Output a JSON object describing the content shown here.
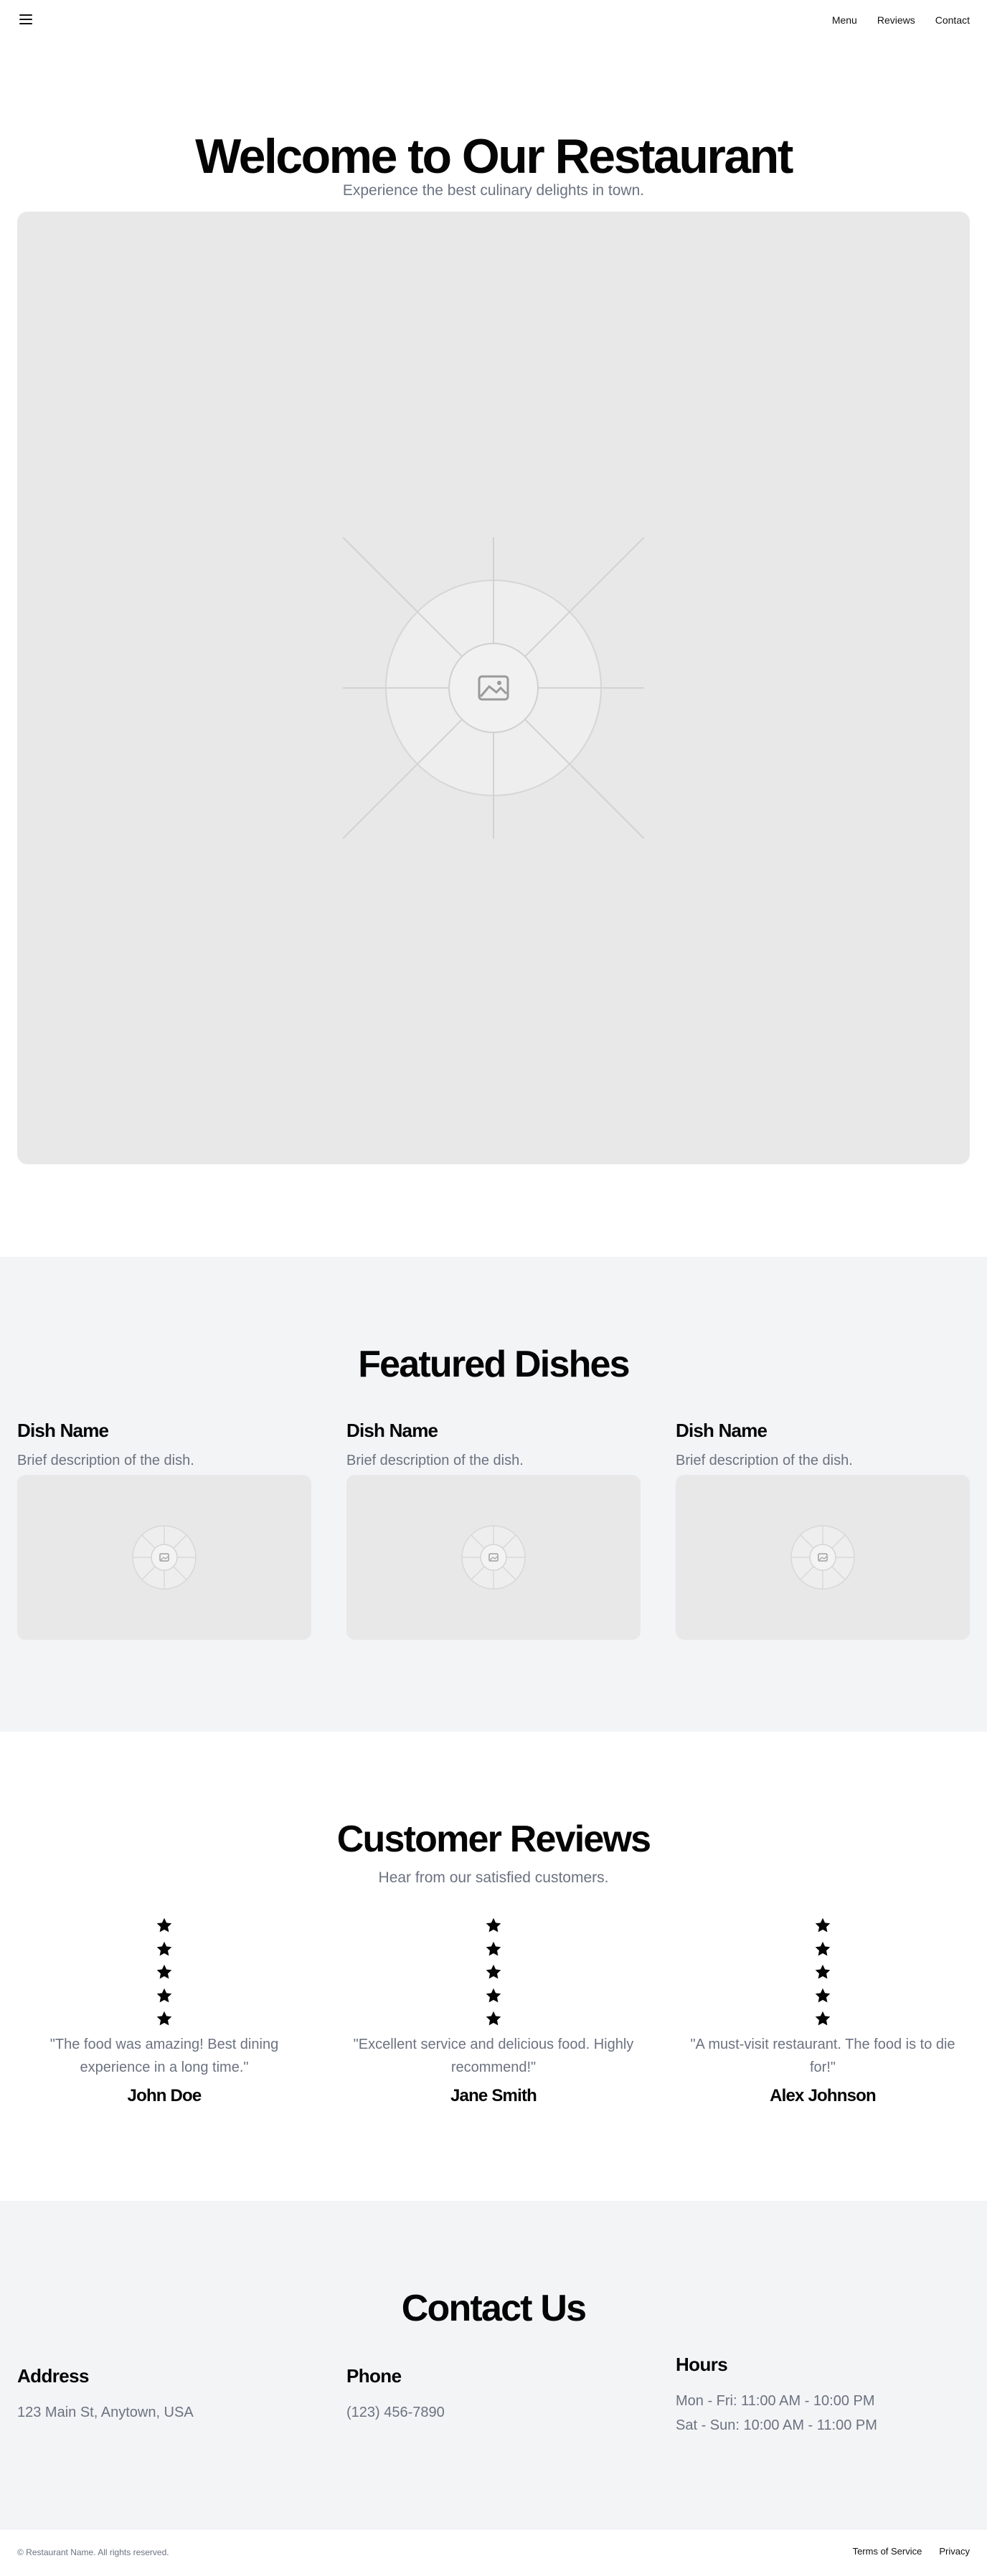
{
  "header": {
    "menu_icon": "hamburger-menu-icon",
    "nav": [
      "Menu",
      "Reviews",
      "Contact"
    ]
  },
  "hero": {
    "title": "Welcome to Our Restaurant",
    "subtitle": "Experience the best culinary delights in town.",
    "image_icon": "image-placeholder-icon"
  },
  "featured": {
    "title": "Featured Dishes",
    "dishes": [
      {
        "name": "Dish Name",
        "description": "Brief description of the dish."
      },
      {
        "name": "Dish Name",
        "description": "Brief description of the dish."
      },
      {
        "name": "Dish Name",
        "description": "Brief description of the dish."
      }
    ]
  },
  "reviews": {
    "title": "Customer Reviews",
    "subtitle": "Hear from our satisfied customers.",
    "items": [
      {
        "rating": 5,
        "text": "\"The food was amazing! Best dining experience in a long time.\"",
        "author": "John Doe"
      },
      {
        "rating": 5,
        "text": "\"Excellent service and delicious food. Highly recommend!\"",
        "author": "Jane Smith"
      },
      {
        "rating": 5,
        "text": "\"A must-visit restaurant. The food is to die for!\"",
        "author": "Alex Johnson"
      }
    ]
  },
  "contact": {
    "title": "Contact Us",
    "address": {
      "heading": "Address",
      "lines": [
        "123 Main St, Anytown, USA"
      ]
    },
    "phone": {
      "heading": "Phone",
      "lines": [
        "(123) 456-7890"
      ]
    },
    "hours": {
      "heading": "Hours",
      "lines": [
        "Mon - Fri: 11:00 AM - 10:00 PM",
        "Sat - Sun: 10:00 AM - 11:00 PM"
      ]
    }
  },
  "footer": {
    "copyright": "© Restaurant Name. All rights reserved.",
    "links": [
      "Terms of Service",
      "Privacy"
    ]
  },
  "colors": {
    "text": "#0a0a0a",
    "muted": "#6b7280",
    "section_bg": "#f3f4f6",
    "placeholder_bg": "#e8e8e8"
  }
}
